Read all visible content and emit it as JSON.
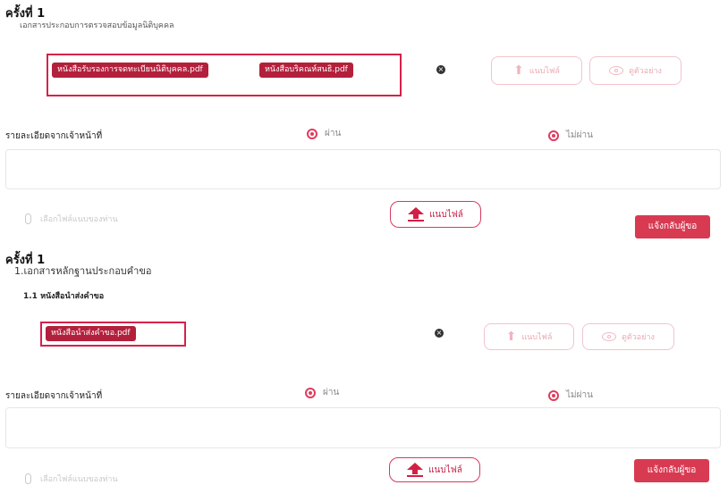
{
  "section1": {
    "round_title": "ครั้งที่ 1",
    "subtitle": "เอกสารประกอบการตรวจสอบข้อมูลนิติบุคคล",
    "files": [
      "หนังสือรับรองการจดทะเบียนนิติบุคคล.pdf",
      "หนังสือบริคณห์สนธิ.pdf"
    ],
    "remove_symbol": "×",
    "upload_label": "แนบไฟล์",
    "preview_label": "ดูตัวอย่าง",
    "officer_label": "รายละเอียดจากเจ้าหน้าที่",
    "pass_label": "ผ่าน",
    "fail_label": "ไม่ผ่าน",
    "attach_placeholder": "เลือกไฟล์แนบของท่าน",
    "attach_button": "แนบไฟล์",
    "return_button": "แจ้งกลับผู้ขอ"
  },
  "section2": {
    "round_title": "ครั้งที่ 1",
    "doc_heading": "1.เอกสารหลักฐานประกอบคำขอ",
    "doc_sub": "1.1 หนังสือนำส่งคำขอ",
    "files": [
      "หนังสือนำส่งคำขอ.pdf"
    ],
    "remove_symbol": "×",
    "upload_label": "แนบไฟล์",
    "preview_label": "ดูตัวอย่าง",
    "officer_label": "รายละเอียดจากเจ้าหน้าที่",
    "pass_label": "ผ่าน",
    "fail_label": "ไม่ผ่าน",
    "attach_placeholder": "เลือกไฟล์แนบของท่าน",
    "attach_button": "แนบไฟล์",
    "return_button": "แจ้งกลับผู้ขอ"
  },
  "colors": {
    "accent": "#d83a52",
    "file_chip": "#b3203c",
    "highlight": "#d6214a"
  },
  "icons": [
    "remove-icon",
    "upload-icon",
    "eye-icon",
    "paperclip-icon",
    "radio-icon"
  ]
}
